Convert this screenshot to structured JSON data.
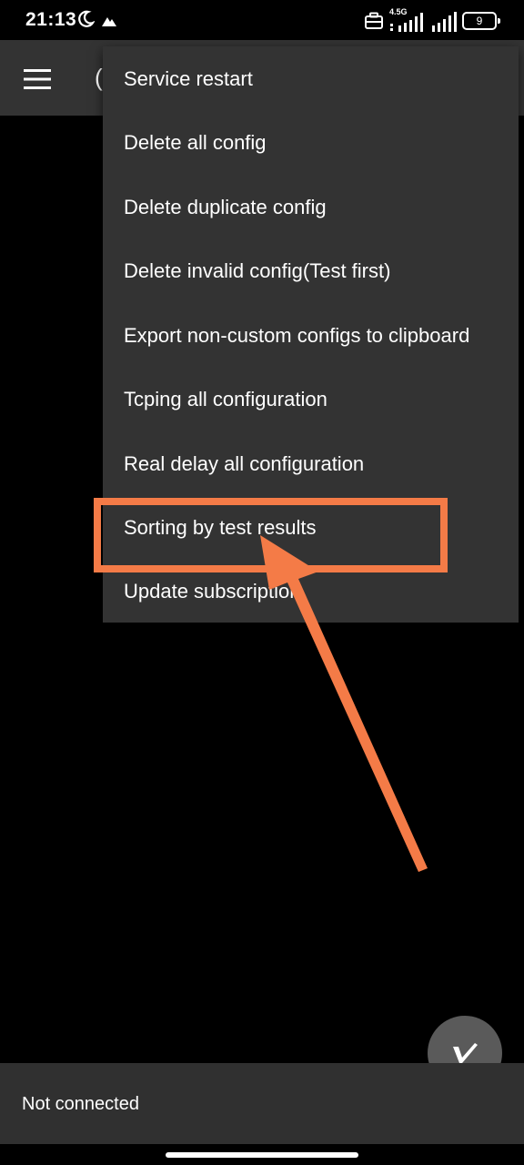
{
  "status_bar": {
    "time": "21:13",
    "network_label": "4.5G",
    "battery_level": "9",
    "icons": [
      "moon-icon",
      "warning-icon",
      "briefcase-icon",
      "signal-icon",
      "signal-icon",
      "battery-icon"
    ]
  },
  "app_bar": {
    "title_fragment": "(",
    "menu_icon": "hamburger-icon"
  },
  "popup_menu": {
    "items": [
      {
        "label": "Service restart"
      },
      {
        "label": "Delete all config"
      },
      {
        "label": "Delete duplicate config"
      },
      {
        "label": "Delete invalid config(Test first)"
      },
      {
        "label": "Export non-custom configs to clipboard"
      },
      {
        "label": "Tcping all configuration"
      },
      {
        "label": "Real delay all configuration"
      },
      {
        "label": "Sorting by test results"
      },
      {
        "label": "Update subscription"
      }
    ],
    "highlighted_item": "Sorting by test results"
  },
  "annotation": {
    "color": "#f47b47"
  },
  "fab": {
    "icon": "v-logo-icon"
  },
  "bottom_status": {
    "text": "Not connected"
  },
  "colors": {
    "background": "#000000",
    "toolbar": "#333333",
    "menu": "#333333",
    "accent_annotation": "#f47b47",
    "fab": "#5a5a5a"
  }
}
